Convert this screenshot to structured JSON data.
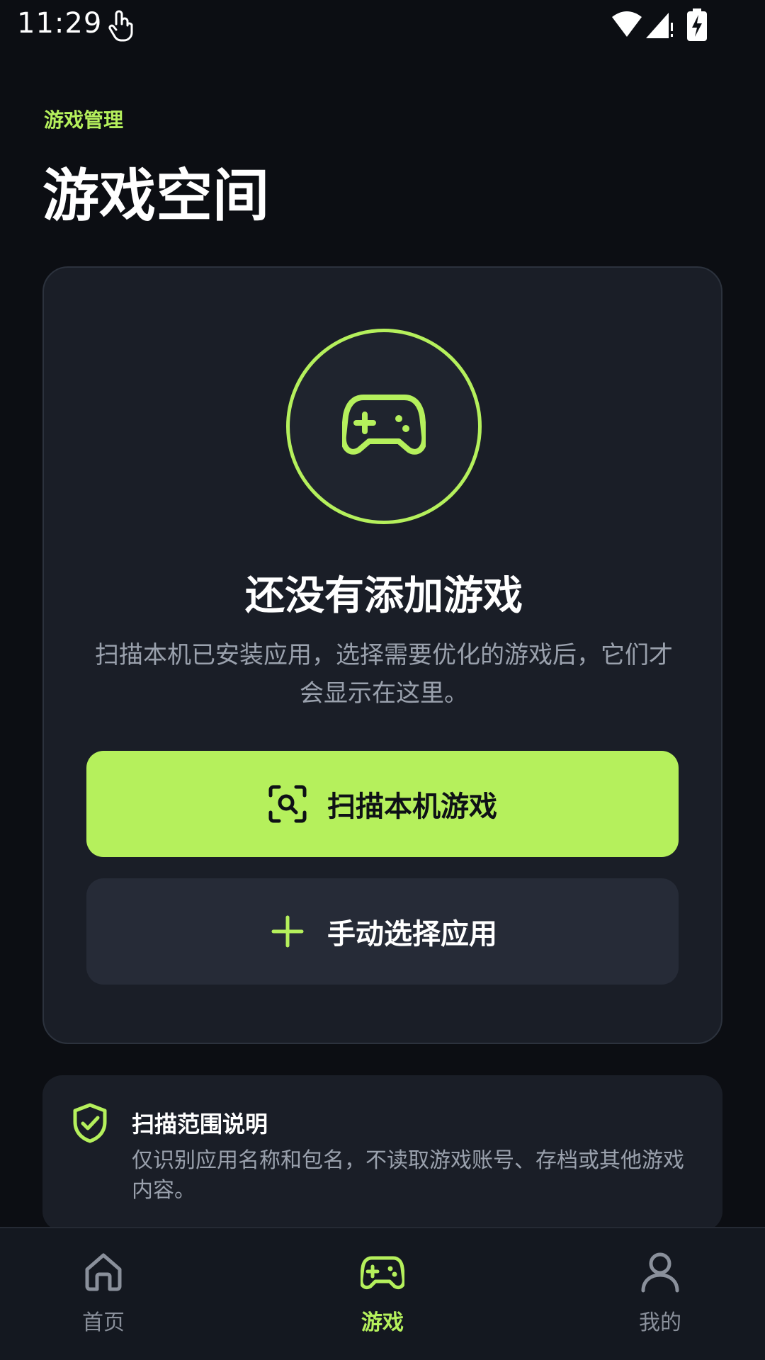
{
  "status_bar": {
    "time": "11:29",
    "icons": [
      "touch-icon",
      "wifi-icon",
      "signal-icon",
      "battery-charging-icon"
    ]
  },
  "header": {
    "subtitle": "游戏管理",
    "title": "游戏空间"
  },
  "empty_state": {
    "icon": "gamepad-icon",
    "title": "还没有添加游戏",
    "description": "扫描本机已安装应用，选择需要优化的游戏后，它们才会显示在这里。"
  },
  "actions": {
    "scan_label": "扫描本机游戏",
    "scan_icon": "scan-search-icon",
    "manual_label": "手动选择应用",
    "manual_icon": "plus-icon"
  },
  "info": {
    "icon": "shield-check-icon",
    "title": "扫描范围说明",
    "description": "仅识别应用名称和包名，不读取游戏账号、存档或其他游戏内容。"
  },
  "bottom_nav": {
    "items": [
      {
        "label": "首页",
        "icon": "home-icon",
        "active": false
      },
      {
        "label": "游戏",
        "icon": "gamepad-icon",
        "active": true
      },
      {
        "label": "我的",
        "icon": "user-icon",
        "active": false
      }
    ]
  },
  "colors": {
    "accent": "#b5f05c",
    "background": "#0c0e13",
    "card": "#1a1e27",
    "muted_text": "#9aa1ad"
  }
}
